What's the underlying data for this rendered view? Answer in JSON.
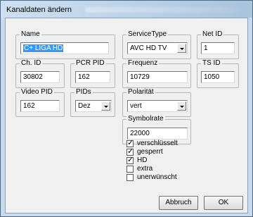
{
  "window": {
    "title": "Kanaldaten ändern"
  },
  "groups": {
    "name": {
      "label": "Name",
      "value_prefix": "C+",
      "value_rest": " LIGA HD"
    },
    "service_type": {
      "label": "ServiceType",
      "value": "AVC HD TV"
    },
    "net_id": {
      "label": "Net ID",
      "value": "1"
    },
    "ch_id": {
      "label": "Ch. ID",
      "value": "30802"
    },
    "pcr_pid": {
      "label": "PCR PID",
      "value": "162"
    },
    "frequenz": {
      "label": "Frequenz",
      "value": "10729"
    },
    "ts_id": {
      "label": "TS ID",
      "value": "1050"
    },
    "video_pid": {
      "label": "Video PID",
      "value": "162"
    },
    "pids": {
      "label": "PIDs",
      "value": "Dez"
    },
    "polaritaet": {
      "label": "Polarität",
      "value": "vert"
    },
    "symbolrate": {
      "label": "Symbolrate",
      "value": "22000"
    }
  },
  "checkboxes": [
    {
      "label": "verschlüsselt",
      "checked": true
    },
    {
      "label": "gesperrt",
      "checked": true
    },
    {
      "label": "HD",
      "checked": true
    },
    {
      "label": "extra",
      "checked": false
    },
    {
      "label": "unerwünscht",
      "checked": false
    }
  ],
  "buttons": {
    "cancel": "Abbruch",
    "ok": "OK"
  }
}
